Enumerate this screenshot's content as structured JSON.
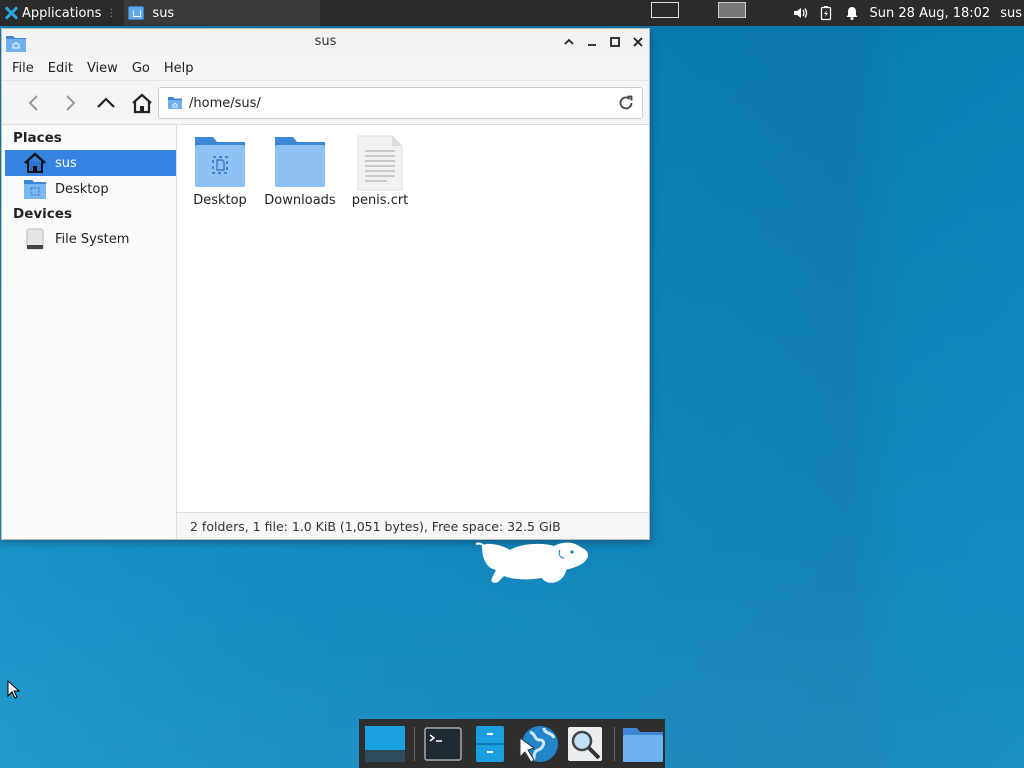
{
  "panel": {
    "applications_label": "Applications",
    "task_title": "sus",
    "clock": "Sun 28 Aug, 18:02",
    "user": "sus"
  },
  "window": {
    "title": "sus",
    "menu": [
      "File",
      "Edit",
      "View",
      "Go",
      "Help"
    ],
    "location": "/home/sus/"
  },
  "sidebar": {
    "places_heading": "Places",
    "places": [
      {
        "label": "sus",
        "icon": "home-icon",
        "selected": true
      },
      {
        "label": "Desktop",
        "icon": "desktop-folder-icon",
        "selected": false
      }
    ],
    "devices_heading": "Devices",
    "devices": [
      {
        "label": "File System",
        "icon": "drive-icon"
      }
    ]
  },
  "files": [
    {
      "name": "Desktop",
      "icon": "desktop-folder-icon"
    },
    {
      "name": "Downloads",
      "icon": "folder-icon"
    },
    {
      "name": "penis.crt",
      "icon": "text-file-icon"
    }
  ],
  "status": "2 folders, 1 file: 1.0 KiB (1,051 bytes), Free space: 32.5 GiB",
  "colors": {
    "accent": "#3584e4",
    "desktop": "#0a86be",
    "panel": "#2b2b2b"
  }
}
